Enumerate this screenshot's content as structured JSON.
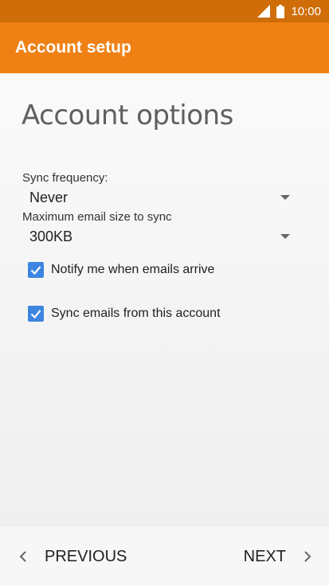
{
  "status_bar": {
    "time": "10:00",
    "signal_icon": "signal-icon",
    "battery_icon": "battery-icon"
  },
  "app_bar": {
    "title": "Account setup"
  },
  "page": {
    "title": "Account options"
  },
  "sync_frequency": {
    "label": "Sync frequency:",
    "value": "Never"
  },
  "max_email_size": {
    "label": "Maximum email size to sync",
    "value": "300KB"
  },
  "checkboxes": [
    {
      "label": "Notify me when emails arrive",
      "checked": true
    },
    {
      "label": "Sync emails from this account",
      "checked": true
    }
  ],
  "navigation": {
    "previous_label": "PREVIOUS",
    "next_label": "NEXT"
  },
  "colors": {
    "status_bar": "#cf6e09",
    "app_bar": "#ef8014",
    "checkbox": "#3d85e0"
  }
}
